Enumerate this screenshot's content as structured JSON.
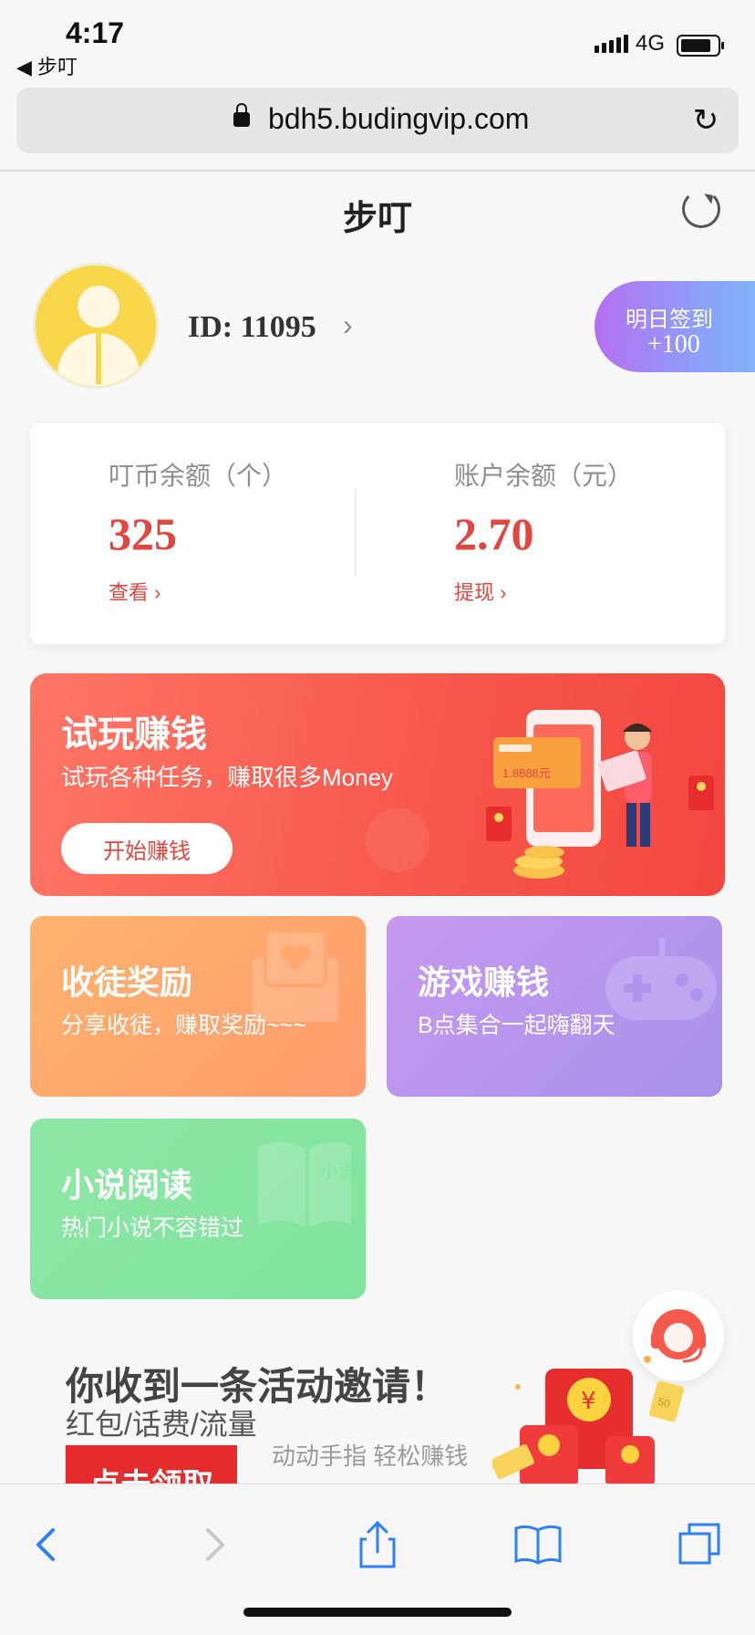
{
  "status_bar": {
    "time": "4:17",
    "back_app": "◀ 步叮",
    "network": "4G"
  },
  "browser": {
    "url": "bdh5.budingvip.com",
    "reload_icon": "reload-icon"
  },
  "header": {
    "title": "步叮",
    "refresh_icon": "refresh-icon"
  },
  "profile": {
    "id_text": "ID: 11095",
    "signin_line1": "明日签到",
    "signin_line2": "+100"
  },
  "balances": {
    "coins_label": "叮币余额（个）",
    "coins_value": "325",
    "coins_link": "查看",
    "account_label": "账户余额（元）",
    "account_value": "2.70",
    "account_link": "提现"
  },
  "banner": {
    "title": "试玩赚钱",
    "subtitle": "试玩各种任务，赚取很多Money",
    "button": "开始赚钱",
    "card_text": "1.8888元"
  },
  "cards": [
    {
      "title": "收徒奖励",
      "subtitle": "分享收徒，赚取奖励~~~"
    },
    {
      "title": "游戏赚钱",
      "subtitle": "B点集合一起嗨翻天"
    },
    {
      "title": "小说阅读",
      "subtitle": "热门小说不容错过",
      "deco_text": "小说"
    }
  ],
  "invite": {
    "title": "你收到一条活动邀请！",
    "subtitle": "红包/话费/流量",
    "tagline": "动动手指 轻松赚钱",
    "button": "点击领取",
    "coin_symbol": "¥",
    "coin_label": "50"
  },
  "colors": {
    "accent_red": "#e3463e",
    "signin_purple": "#b56ff2",
    "recruit_orange": "#ffb46e",
    "game_purple": "#c799ef",
    "novel_green": "#8fe6a6",
    "link_blue": "#2f7ff5"
  },
  "toolbar": {
    "back_icon": "back-chevron-icon",
    "forward_icon": "forward-chevron-icon",
    "share_icon": "share-icon",
    "bookmarks_icon": "bookmarks-icon",
    "tabs_icon": "tabs-icon"
  }
}
